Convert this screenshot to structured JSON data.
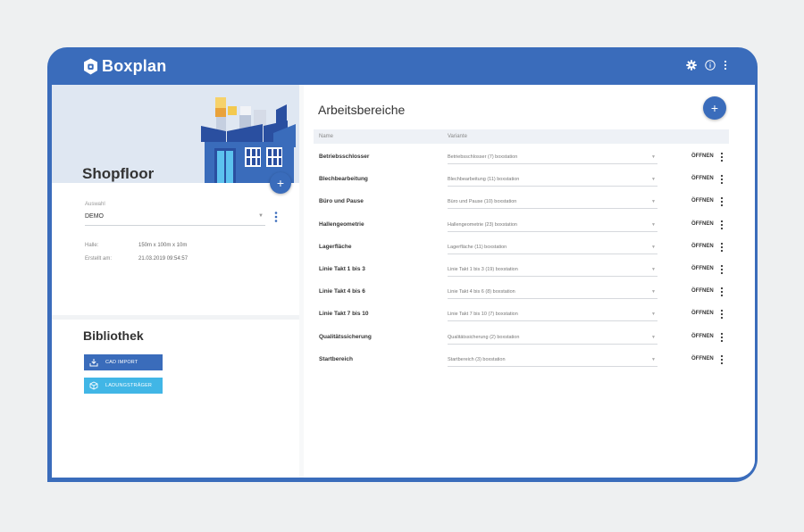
{
  "app": {
    "name": "Boxplan"
  },
  "appbar": {
    "icons": [
      "gear-icon",
      "info-icon",
      "more-vert-icon"
    ]
  },
  "left": {
    "title": "Shopfloor",
    "add_label": "+",
    "select": {
      "label": "Auswahl",
      "value": "DEMO"
    },
    "info": [
      {
        "label": "Halle:",
        "value": "150m x 100m x 10m"
      },
      {
        "label": "Erstellt am:",
        "value": "21.03.2019 09:54:57"
      }
    ],
    "library": {
      "title": "Bibliothek",
      "buttons": [
        {
          "label": "CAD IMPORT",
          "icon": "download-icon",
          "color": "#3a6cbb"
        },
        {
          "label": "LADUNGSTRÄGER",
          "icon": "box-icon",
          "color": "#41b6e6"
        }
      ]
    }
  },
  "main": {
    "title": "Arbeitsbereiche",
    "add_label": "+",
    "columns": {
      "name": "Name",
      "variant": "Variante"
    },
    "open_label": "ÖFFNEN",
    "rows": [
      {
        "name": "Betriebsschlosser",
        "variant": "Betriebsschlosser (7) boxstation"
      },
      {
        "name": "Blechbearbeitung",
        "variant": "Blechbearbeitung (11) boxstation"
      },
      {
        "name": "Büro und Pause",
        "variant": "Büro und Pause (10) boxstation"
      },
      {
        "name": "Hallengeometrie",
        "variant": "Hallengeometrie (23) boxstation"
      },
      {
        "name": "Lagerfläche",
        "variant": "Lagerfläche (11) boxstation"
      },
      {
        "name": "Linie Takt 1 bis 3",
        "variant": "Linie Takt 1 bis 3 (19) boxstation"
      },
      {
        "name": "Linie Takt 4 bis 6",
        "variant": "Linie Takt 4 bis 6 (8) boxstation"
      },
      {
        "name": "Linie Takt 7 bis 10",
        "variant": "Linie Takt 7 bis 10 (7) boxstation"
      },
      {
        "name": "Qualitätssicherung",
        "variant": "Qualitätssicherung (2) boxstation"
      },
      {
        "name": "Startbereich",
        "variant": "Startbereich (3) boxstation"
      }
    ]
  },
  "colors": {
    "primary": "#3a6cbb",
    "accent": "#41b6e6"
  }
}
